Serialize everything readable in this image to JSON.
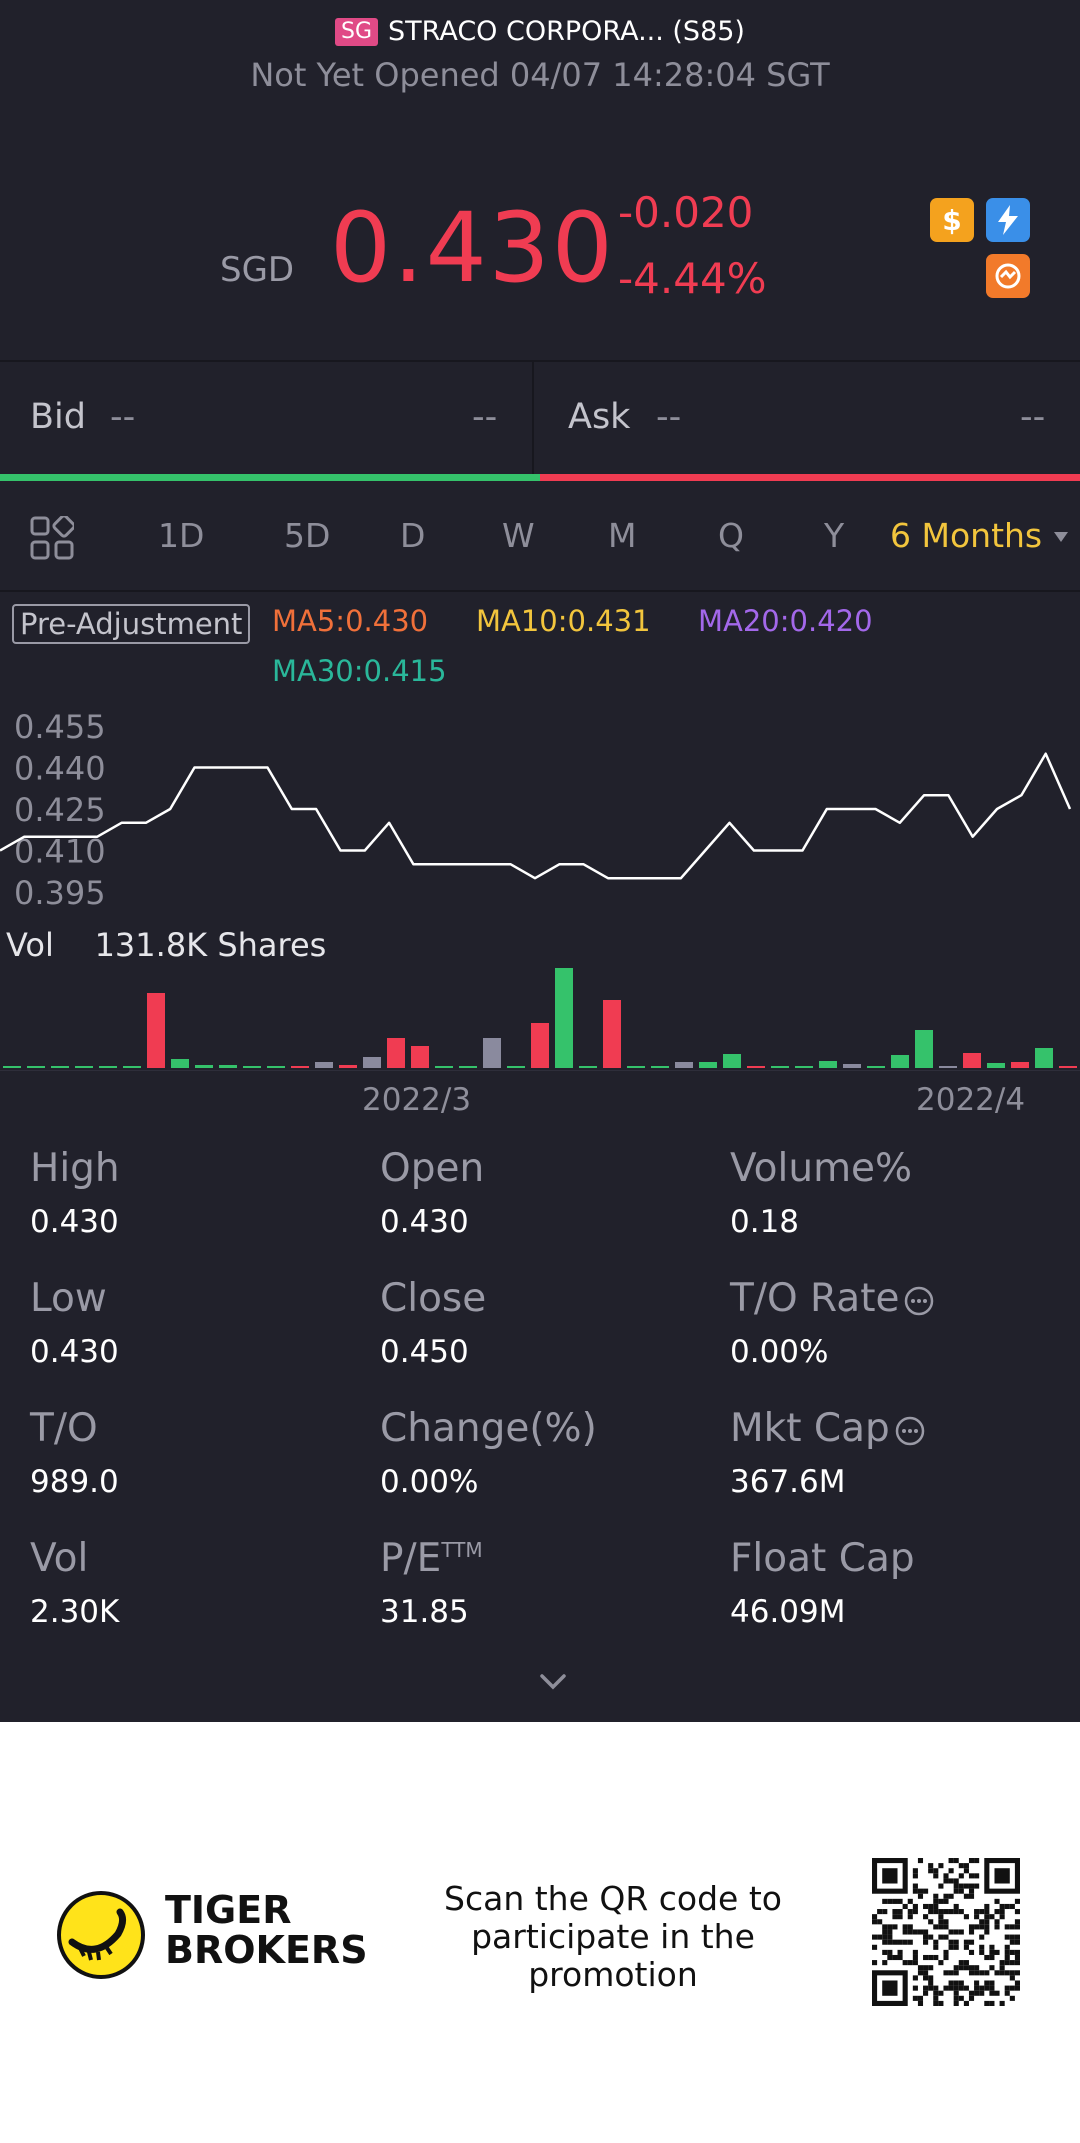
{
  "header": {
    "market_flag": "SG",
    "stock_name": "STRACO CORPORA... (S85)",
    "status_line": "Not Yet Opened 04/07 14:28:04 SGT"
  },
  "quote": {
    "currency": "SGD",
    "price": "0.430",
    "change_abs": "-0.020",
    "change_pct": "-4.44%",
    "badges": [
      "dollar-icon",
      "flash-icon",
      "shield-icon"
    ],
    "colors": {
      "down": "#f03c52",
      "up": "#35c26b",
      "accent": "#f2c53d"
    }
  },
  "bid_ask": {
    "bid_label": "Bid",
    "bid_price": "--",
    "bid_size": "--",
    "ask_label": "Ask",
    "ask_price": "--",
    "ask_size": "--"
  },
  "tabs": {
    "items": [
      "1D",
      "5D",
      "D",
      "W",
      "M",
      "Q",
      "Y"
    ],
    "active": "6 Months"
  },
  "indicators": {
    "adjustment": "Pre-Adjustment",
    "ma5": "MA5:0.430",
    "ma10": "MA10:0.431",
    "ma20": "MA20:0.420",
    "ma30": "MA30:0.415",
    "colors": {
      "ma5": "#f0703a",
      "ma10": "#f2c53d",
      "ma20": "#a368ea",
      "ma30": "#2ab79a"
    }
  },
  "chart_data": {
    "type": "line",
    "y_ticks": [
      "0.455",
      "0.440",
      "0.425",
      "0.410",
      "0.395"
    ],
    "ylim": [
      0.395,
      0.455
    ],
    "x_ticks": [
      "2022/3",
      "2022/4"
    ],
    "values": [
      0.41,
      0.415,
      0.415,
      0.415,
      0.415,
      0.42,
      0.42,
      0.425,
      0.44,
      0.44,
      0.44,
      0.44,
      0.425,
      0.425,
      0.41,
      0.41,
      0.42,
      0.405,
      0.405,
      0.405,
      0.405,
      0.405,
      0.4,
      0.405,
      0.405,
      0.4,
      0.4,
      0.4,
      0.4,
      0.41,
      0.42,
      0.41,
      0.41,
      0.41,
      0.425,
      0.425,
      0.425,
      0.42,
      0.43,
      0.43,
      0.415,
      0.425,
      0.43,
      0.445,
      0.425
    ],
    "volume_label": "Vol",
    "volume_value": "131.8K Shares",
    "volume": {
      "bars": [
        {
          "v": 1,
          "c": "up"
        },
        {
          "v": 0,
          "c": "up"
        },
        {
          "v": 1,
          "c": "up"
        },
        {
          "v": 0,
          "c": "up"
        },
        {
          "v": 0,
          "c": "up"
        },
        {
          "v": 1,
          "c": "up"
        },
        {
          "v": 75,
          "c": "down"
        },
        {
          "v": 9,
          "c": "up"
        },
        {
          "v": 3,
          "c": "up"
        },
        {
          "v": 3,
          "c": "up"
        },
        {
          "v": 0,
          "c": "up"
        },
        {
          "v": 0,
          "c": "up"
        },
        {
          "v": 1,
          "c": "down"
        },
        {
          "v": 6,
          "c": "flat"
        },
        {
          "v": 3,
          "c": "down"
        },
        {
          "v": 11,
          "c": "flat"
        },
        {
          "v": 30,
          "c": "down"
        },
        {
          "v": 22,
          "c": "down"
        },
        {
          "v": 0,
          "c": "up"
        },
        {
          "v": 0,
          "c": "up"
        },
        {
          "v": 30,
          "c": "flat"
        },
        {
          "v": 0,
          "c": "up"
        },
        {
          "v": 45,
          "c": "down"
        },
        {
          "v": 100,
          "c": "up"
        },
        {
          "v": 0,
          "c": "up"
        },
        {
          "v": 68,
          "c": "down"
        },
        {
          "v": 0,
          "c": "up"
        },
        {
          "v": 0,
          "c": "up"
        },
        {
          "v": 6,
          "c": "flat"
        },
        {
          "v": 6,
          "c": "up"
        },
        {
          "v": 14,
          "c": "up"
        },
        {
          "v": 2,
          "c": "down"
        },
        {
          "v": 0,
          "c": "up"
        },
        {
          "v": 0,
          "c": "up"
        },
        {
          "v": 7,
          "c": "up"
        },
        {
          "v": 4,
          "c": "flat"
        },
        {
          "v": 0,
          "c": "up"
        },
        {
          "v": 13,
          "c": "up"
        },
        {
          "v": 38,
          "c": "up"
        },
        {
          "v": 1,
          "c": "flat"
        },
        {
          "v": 15,
          "c": "down"
        },
        {
          "v": 5,
          "c": "up"
        },
        {
          "v": 6,
          "c": "down"
        },
        {
          "v": 20,
          "c": "up"
        },
        {
          "v": 2,
          "c": "down"
        }
      ]
    }
  },
  "stats": [
    {
      "label": "High",
      "value": "0.430"
    },
    {
      "label": "Open",
      "value": "0.430"
    },
    {
      "label": "Volume%",
      "value": "0.18"
    },
    {
      "label": "Low",
      "value": "0.430"
    },
    {
      "label": "Close",
      "value": "0.450"
    },
    {
      "label": "T/O Rate",
      "value": "0.00%"
    },
    {
      "label": "T/O",
      "value": "989.0"
    },
    {
      "label": "Change(%)",
      "value": "0.00%"
    },
    {
      "label": "Mkt Cap",
      "value": "367.6M"
    },
    {
      "label": "Vol",
      "value": "2.30K"
    },
    {
      "label": "P/E",
      "label_sup": "TTM",
      "value": "31.85"
    },
    {
      "label": "Float Cap",
      "value": "46.09M"
    }
  ],
  "promo": {
    "brand_line1": "TIGER",
    "brand_line2": "BROKERS",
    "text_line1": "Scan the QR code to",
    "text_line2": "participate in the",
    "text_line3": "promotion"
  }
}
